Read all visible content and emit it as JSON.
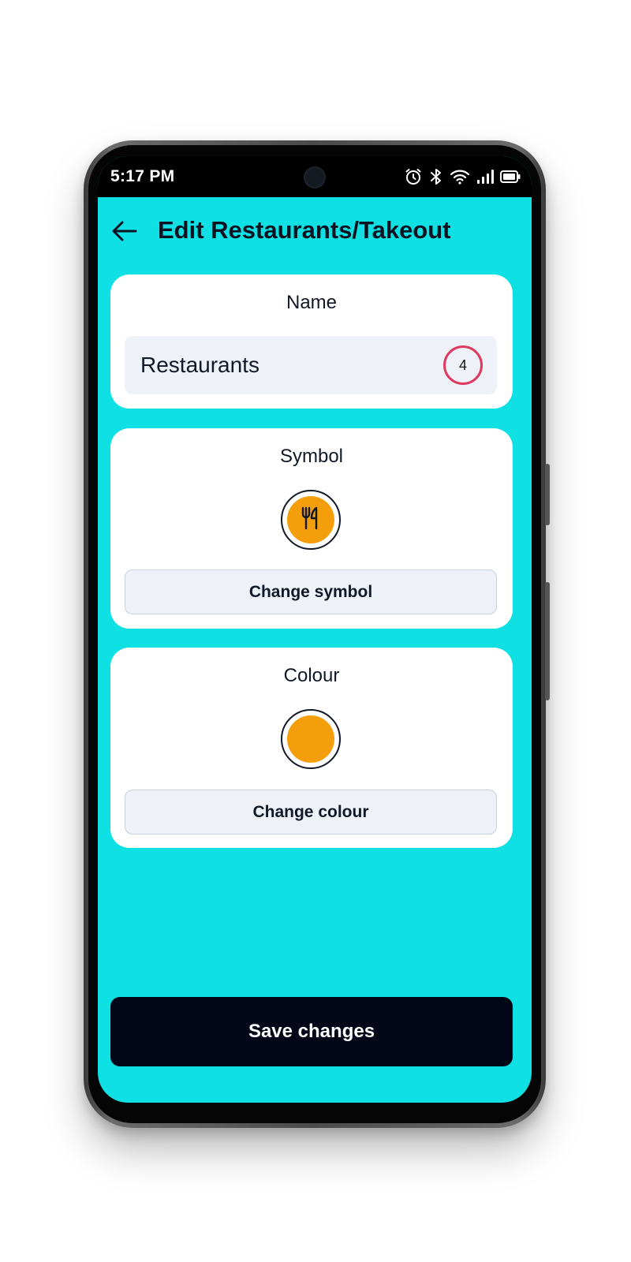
{
  "status_bar": {
    "time": "5:17 PM",
    "icons": [
      "alarm-icon",
      "bluetooth-icon",
      "wifi-icon",
      "signal-icon",
      "battery-icon"
    ]
  },
  "header": {
    "back_icon": "arrow-left-icon",
    "title": "Edit Restaurants/Takeout"
  },
  "name_section": {
    "title": "Name",
    "value": "Restaurants",
    "counter": "4"
  },
  "symbol_section": {
    "title": "Symbol",
    "icon": "fork-knife-icon",
    "button_label": "Change symbol"
  },
  "colour_section": {
    "title": "Colour",
    "button_label": "Change colour"
  },
  "footer": {
    "save_label": "Save changes"
  },
  "colors": {
    "background": "#0fe0e3",
    "accent": "#f59e0b",
    "counter_ring": "#e0395f",
    "save_button": "#020617",
    "card": "#ffffff",
    "input_fill": "#eef2f8"
  }
}
